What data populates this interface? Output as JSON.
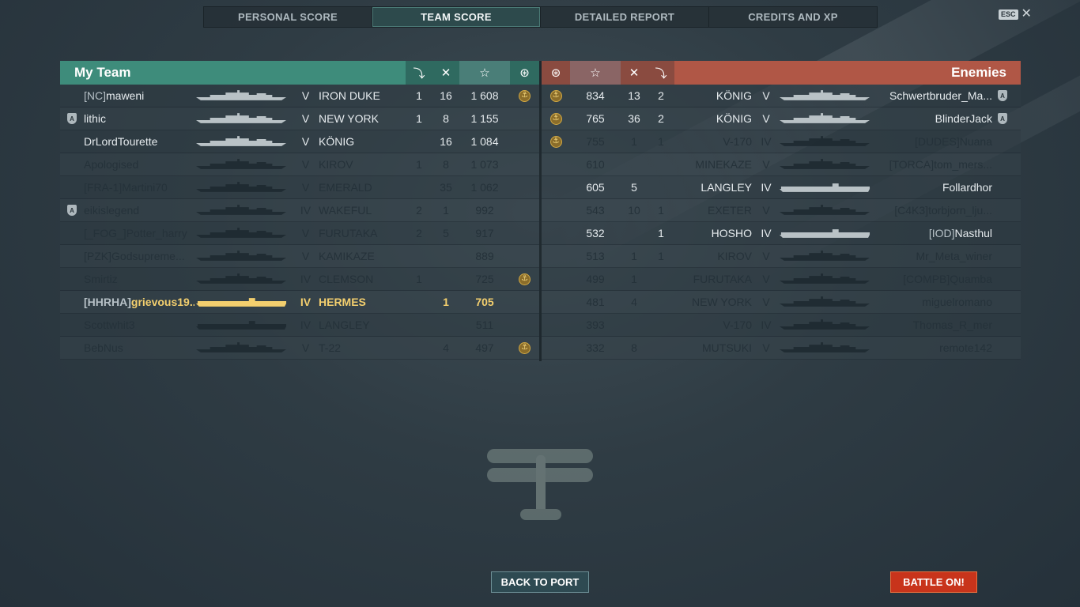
{
  "tabs": [
    "PERSONAL SCORE",
    "TEAM SCORE",
    "DETAILED REPORT",
    "CREDITS AND XP"
  ],
  "active_tab": 1,
  "esc_key": "ESC",
  "close_glyph": "✕",
  "my_team": {
    "title": "My Team",
    "header_icons": [
      "torpedo-icon",
      "crossed-swords-icon",
      "star-icon",
      "medal-icon"
    ],
    "header_glyphs": [
      "⤵",
      "✕",
      "☆",
      "⊛"
    ],
    "rows": [
      {
        "badge": "",
        "clan": "[NC]",
        "name": "maweni",
        "tier": "V",
        "ship": "IRON DUKE",
        "k1": "1",
        "k2": "16",
        "xp": "1 608",
        "medal": true,
        "state": "alive"
      },
      {
        "badge": "A",
        "clan": "",
        "name": "lithic",
        "tier": "V",
        "ship": "NEW YORK",
        "k1": "1",
        "k2": "8",
        "xp": "1 155",
        "medal": false,
        "state": "alive"
      },
      {
        "badge": "",
        "clan": "",
        "name": "DrLordTourette",
        "tier": "V",
        "ship": "KÖNIG",
        "k1": "",
        "k2": "16",
        "xp": "1 084",
        "medal": false,
        "state": "alive"
      },
      {
        "badge": "",
        "clan": "",
        "name": "Apologised",
        "tier": "V",
        "ship": "KIROV",
        "k1": "1",
        "k2": "8",
        "xp": "1 073",
        "medal": false,
        "state": "dead"
      },
      {
        "badge": "",
        "clan": "[FRA-1]",
        "name": "Martini70",
        "tier": "V",
        "ship": "EMERALD",
        "k1": "",
        "k2": "35",
        "xp": "1 062",
        "medal": false,
        "state": "dead"
      },
      {
        "badge": "A",
        "clan": "",
        "name": "eikislegend",
        "tier": "IV",
        "ship": "WAKEFUL",
        "k1": "2",
        "k2": "1",
        "xp": "992",
        "medal": false,
        "state": "dead"
      },
      {
        "badge": "",
        "clan": "[_FOG_]",
        "name": "Potter_harry",
        "tier": "V",
        "ship": "FURUTAKA",
        "k1": "2",
        "k2": "5",
        "xp": "917",
        "medal": false,
        "state": "dead"
      },
      {
        "badge": "",
        "clan": "[PZK]",
        "name": "Godsupreme...",
        "tier": "V",
        "ship": "KAMIKAZE",
        "k1": "",
        "k2": "",
        "xp": "889",
        "medal": false,
        "state": "dead",
        "clan_color": "orange"
      },
      {
        "badge": "",
        "clan": "",
        "name": "Smirtiz",
        "tier": "IV",
        "ship": "CLEMSON",
        "k1": "1",
        "k2": "",
        "xp": "725",
        "medal": true,
        "state": "dead"
      },
      {
        "badge": "",
        "clan": "[HHRHA]",
        "name": "grievous19...",
        "tier": "IV",
        "ship": "HERMES",
        "k1": "",
        "k2": "1",
        "xp": "705",
        "medal": false,
        "state": "me"
      },
      {
        "badge": "",
        "clan": "",
        "name": "Scottwhit3",
        "tier": "IV",
        "ship": "LANGLEY",
        "k1": "",
        "k2": "",
        "xp": "511",
        "medal": false,
        "state": "dead"
      },
      {
        "badge": "",
        "clan": "",
        "name": "BebNus",
        "tier": "V",
        "ship": "T-22",
        "k1": "",
        "k2": "4",
        "xp": "497",
        "medal": true,
        "state": "dead"
      }
    ]
  },
  "enemies": {
    "title": "Enemies",
    "header_icons": [
      "medal-icon",
      "star-icon",
      "crossed-swords-icon",
      "torpedo-icon"
    ],
    "header_glyphs": [
      "⊛",
      "☆",
      "✕",
      "⤵"
    ],
    "rows": [
      {
        "medal": true,
        "xp": "834",
        "k2": "13",
        "k1": "2",
        "ship": "KÖNIG",
        "tier": "V",
        "clan": "",
        "name": "Schwertbruder_Ma...",
        "badge": "A",
        "state": "alive"
      },
      {
        "medal": true,
        "xp": "765",
        "k2": "36",
        "k1": "2",
        "ship": "KÖNIG",
        "tier": "V",
        "clan": "",
        "name": "BlinderJack",
        "badge": "A",
        "state": "alive"
      },
      {
        "medal": true,
        "xp": "755",
        "k2": "1",
        "k1": "1",
        "ship": "V-170",
        "tier": "IV",
        "clan": "[DUDES]",
        "name": "Nuana",
        "badge": "",
        "state": "dead",
        "clan_color": "green"
      },
      {
        "medal": false,
        "xp": "610",
        "k2": "",
        "k1": "",
        "ship": "MINEKAZE",
        "tier": "V",
        "clan": "[TORCA]",
        "name": "tom_mers...",
        "badge": "",
        "state": "dead"
      },
      {
        "medal": false,
        "xp": "605",
        "k2": "5",
        "k1": "",
        "ship": "LANGLEY",
        "tier": "IV",
        "clan": "",
        "name": "Follardhor",
        "badge": "",
        "state": "alive"
      },
      {
        "medal": false,
        "xp": "543",
        "k2": "10",
        "k1": "1",
        "ship": "EXETER",
        "tier": "V",
        "clan": "[C4K3]",
        "name": "torbjorn_lju...",
        "badge": "",
        "state": "dead"
      },
      {
        "medal": false,
        "xp": "532",
        "k2": "",
        "k1": "1",
        "ship": "HOSHO",
        "tier": "IV",
        "clan": "[IOD]",
        "name": "Nasthul",
        "badge": "",
        "state": "alive"
      },
      {
        "medal": false,
        "xp": "513",
        "k2": "1",
        "k1": "1",
        "ship": "KIROV",
        "tier": "V",
        "clan": "",
        "name": "Mr_Meta_winer",
        "badge": "",
        "state": "dead"
      },
      {
        "medal": false,
        "xp": "499",
        "k2": "1",
        "k1": "",
        "ship": "FURUTAKA",
        "tier": "V",
        "clan": "[COMPB]",
        "name": "Quamba",
        "badge": "",
        "state": "dead"
      },
      {
        "medal": false,
        "xp": "481",
        "k2": "4",
        "k1": "",
        "ship": "NEW YORK",
        "tier": "V",
        "clan": "",
        "name": "miguelromano",
        "badge": "",
        "state": "dead"
      },
      {
        "medal": false,
        "xp": "393",
        "k2": "",
        "k1": "",
        "ship": "V-170",
        "tier": "IV",
        "clan": "",
        "name": "Thomas_R_mer",
        "badge": "",
        "state": "dead"
      },
      {
        "medal": false,
        "xp": "332",
        "k2": "8",
        "k1": "",
        "ship": "MUTSUKI",
        "tier": "V",
        "clan": "",
        "name": "remote142",
        "badge": "",
        "state": "dead"
      }
    ]
  },
  "buttons": {
    "back": "BACK TO PORT",
    "battle": "BATTLE ON!"
  },
  "colors": {
    "my_team": "#3e8c7b",
    "enemies": "#b05746",
    "me": "#f3cf6e",
    "battle_button": "#c8341b"
  }
}
